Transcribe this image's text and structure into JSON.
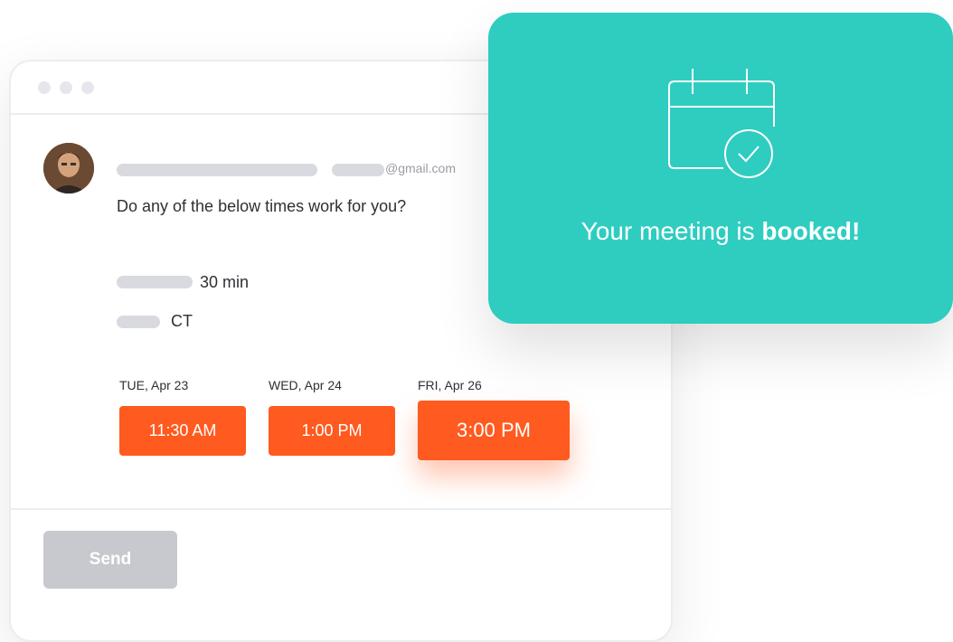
{
  "message": {
    "email_suffix": "@gmail.com",
    "question": "Do any of the below times work for you?",
    "duration": "30 min",
    "timezone": "CT"
  },
  "slots": [
    {
      "day": "TUE, Apr 23",
      "time": "11:30 AM"
    },
    {
      "day": "WED, Apr 24",
      "time": "1:00 PM"
    },
    {
      "day": "FRI, Apr 26",
      "time": "3:00 PM"
    }
  ],
  "footer": {
    "send_label": "Send"
  },
  "confirmation": {
    "text_prefix": "Your meeting is ",
    "text_bold": "booked!",
    "icon": "calendar-check-icon"
  },
  "colors": {
    "accent": "#ff5a1f",
    "teal": "#2ecdc0",
    "send_disabled": "#c7c9cf"
  }
}
